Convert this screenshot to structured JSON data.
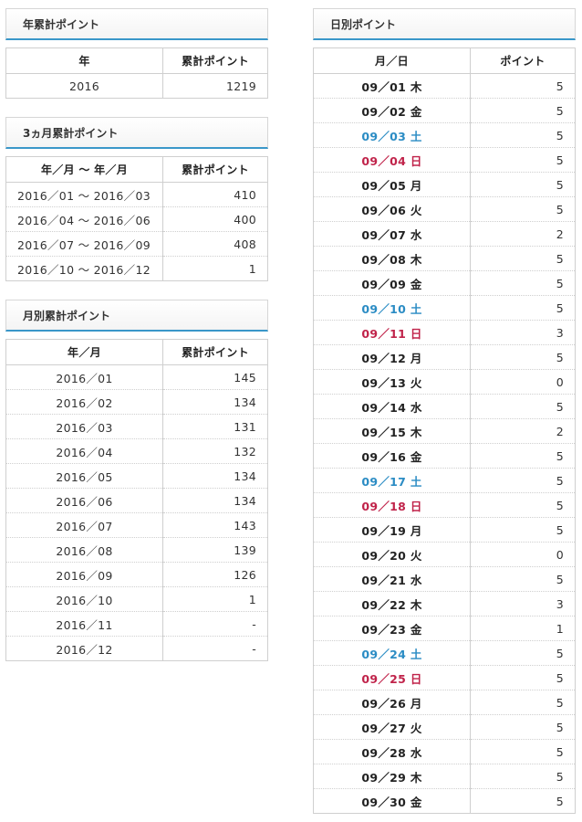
{
  "yearly": {
    "title": "年累計ポイント",
    "headers": [
      "年",
      "累計ポイント"
    ],
    "rows": [
      {
        "period": "2016",
        "points": "1219"
      }
    ]
  },
  "quarterly": {
    "title": "3ヵ月累計ポイント",
    "headers": [
      "年／月 ～ 年／月",
      "累計ポイント"
    ],
    "rows": [
      {
        "period": "2016／01 ～ 2016／03",
        "points": "410"
      },
      {
        "period": "2016／04 ～ 2016／06",
        "points": "400"
      },
      {
        "period": "2016／07 ～ 2016／09",
        "points": "408"
      },
      {
        "period": "2016／10 ～ 2016／12",
        "points": "1"
      }
    ]
  },
  "monthly": {
    "title": "月別累計ポイント",
    "headers": [
      "年／月",
      "累計ポイント"
    ],
    "rows": [
      {
        "period": "2016／01",
        "points": "145"
      },
      {
        "period": "2016／02",
        "points": "134"
      },
      {
        "period": "2016／03",
        "points": "131"
      },
      {
        "period": "2016／04",
        "points": "132"
      },
      {
        "period": "2016／05",
        "points": "134"
      },
      {
        "period": "2016／06",
        "points": "134"
      },
      {
        "period": "2016／07",
        "points": "143"
      },
      {
        "period": "2016／08",
        "points": "139"
      },
      {
        "period": "2016／09",
        "points": "126"
      },
      {
        "period": "2016／10",
        "points": "1"
      },
      {
        "period": "2016／11",
        "points": "-"
      },
      {
        "period": "2016／12",
        "points": "-"
      }
    ]
  },
  "daily": {
    "title": "日別ポイント",
    "headers": [
      "月／日",
      "ポイント"
    ],
    "colors": {
      "weekday": "#222222",
      "saturday": "#2b8cc4",
      "sunday": "#c0234a"
    },
    "rows": [
      {
        "date": "09／01 木",
        "points": "5",
        "kind": "weekday"
      },
      {
        "date": "09／02 金",
        "points": "5",
        "kind": "weekday"
      },
      {
        "date": "09／03 土",
        "points": "5",
        "kind": "sat"
      },
      {
        "date": "09／04 日",
        "points": "5",
        "kind": "sun"
      },
      {
        "date": "09／05 月",
        "points": "5",
        "kind": "weekday"
      },
      {
        "date": "09／06 火",
        "points": "5",
        "kind": "weekday"
      },
      {
        "date": "09／07 水",
        "points": "2",
        "kind": "weekday"
      },
      {
        "date": "09／08 木",
        "points": "5",
        "kind": "weekday"
      },
      {
        "date": "09／09 金",
        "points": "5",
        "kind": "weekday"
      },
      {
        "date": "09／10 土",
        "points": "5",
        "kind": "sat"
      },
      {
        "date": "09／11 日",
        "points": "3",
        "kind": "sun"
      },
      {
        "date": "09／12 月",
        "points": "5",
        "kind": "weekday"
      },
      {
        "date": "09／13 火",
        "points": "0",
        "kind": "weekday"
      },
      {
        "date": "09／14 水",
        "points": "5",
        "kind": "weekday"
      },
      {
        "date": "09／15 木",
        "points": "2",
        "kind": "weekday"
      },
      {
        "date": "09／16 金",
        "points": "5",
        "kind": "weekday"
      },
      {
        "date": "09／17 土",
        "points": "5",
        "kind": "sat"
      },
      {
        "date": "09／18 日",
        "points": "5",
        "kind": "sun"
      },
      {
        "date": "09／19 月",
        "points": "5",
        "kind": "weekday"
      },
      {
        "date": "09／20 火",
        "points": "0",
        "kind": "weekday"
      },
      {
        "date": "09／21 水",
        "points": "5",
        "kind": "weekday"
      },
      {
        "date": "09／22 木",
        "points": "3",
        "kind": "weekday"
      },
      {
        "date": "09／23 金",
        "points": "1",
        "kind": "weekday"
      },
      {
        "date": "09／24 土",
        "points": "5",
        "kind": "sat"
      },
      {
        "date": "09／25 日",
        "points": "5",
        "kind": "sun"
      },
      {
        "date": "09／26 月",
        "points": "5",
        "kind": "weekday"
      },
      {
        "date": "09／27 火",
        "points": "5",
        "kind": "weekday"
      },
      {
        "date": "09／28 水",
        "points": "5",
        "kind": "weekday"
      },
      {
        "date": "09／29 木",
        "points": "5",
        "kind": "weekday"
      },
      {
        "date": "09／30 金",
        "points": "5",
        "kind": "weekday"
      }
    ]
  }
}
